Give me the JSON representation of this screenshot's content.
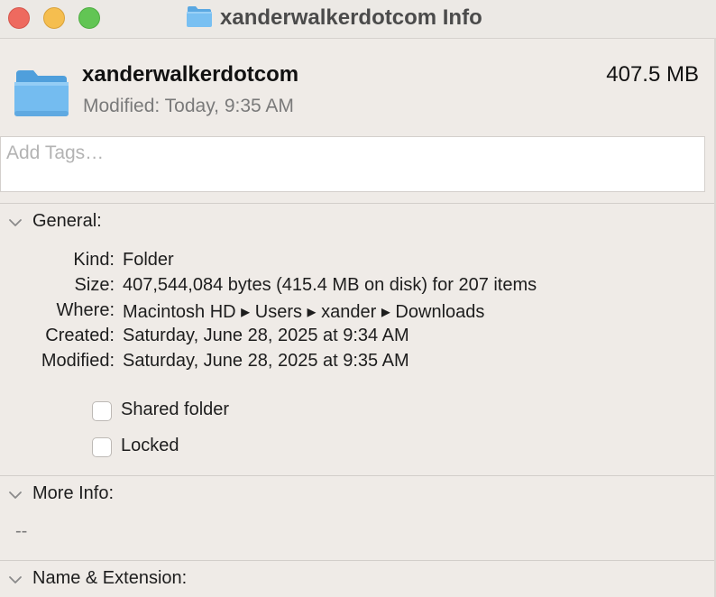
{
  "window": {
    "title": "xanderwalkerdotcom Info"
  },
  "header": {
    "icon": "folder-icon",
    "name": "xanderwalkerdotcom",
    "size": "407.5 MB",
    "modified": "Modified: Today, 9:35 AM"
  },
  "tags": {
    "placeholder": "Add Tags…"
  },
  "general": {
    "title": "General:",
    "rows": [
      {
        "label": "Kind:",
        "value": "Folder"
      },
      {
        "label": "Size:",
        "value": "407,544,084 bytes (415.4 MB on disk) for 207 items"
      },
      {
        "label": "Where:",
        "value": "Macintosh HD ▸ Users ▸ xander ▸ Downloads"
      },
      {
        "label": "Created:",
        "value": "Saturday, June 28, 2025 at 9:34 AM"
      },
      {
        "label": "Modified:",
        "value": "Saturday, June 28, 2025 at 9:35 AM"
      }
    ],
    "shared_folder_label": "Shared folder",
    "locked_label": "Locked"
  },
  "more_info": {
    "title": "More Info:",
    "value": "--"
  },
  "name_extension": {
    "title": "Name & Extension:"
  },
  "colors": {
    "close": "#ee6a5f",
    "minimize": "#f5be4f",
    "maximize": "#62c554",
    "folder": "#6bb8ee"
  }
}
